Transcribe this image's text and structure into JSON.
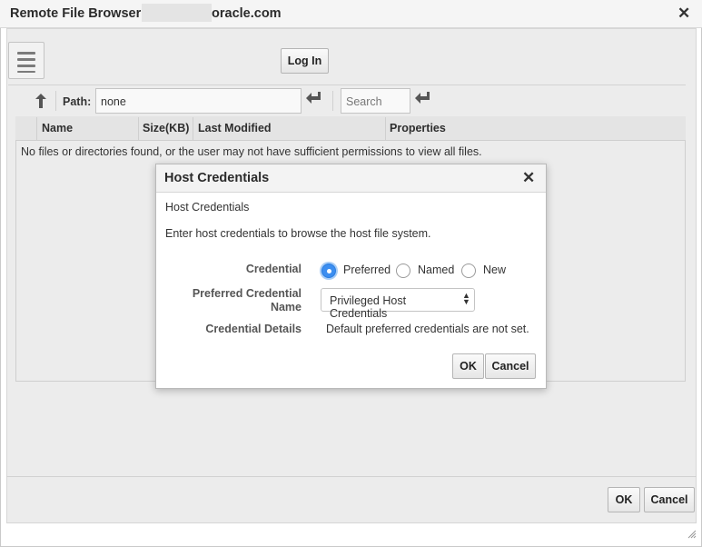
{
  "window": {
    "title_prefix": "Remote File Browser:",
    "title_suffix": "oracle.com"
  },
  "toolbar": {
    "login_label": "Log In",
    "path_label": "Path:",
    "path_value": "none",
    "search_placeholder": "Search"
  },
  "table": {
    "columns": [
      "Name",
      "Size(KB)",
      "Last Modified",
      "Properties"
    ],
    "empty_message": "No files or directories found, or the user may not have sufficient permissions to view all files."
  },
  "footer": {
    "ok_label": "OK",
    "cancel_label": "Cancel"
  },
  "modal": {
    "title": "Host Credentials",
    "subtitle": "Host Credentials",
    "description": "Enter host credentials to browse the host file system.",
    "credential_label": "Credential",
    "credential_options": [
      "Preferred",
      "Named",
      "New"
    ],
    "credential_selected": "Preferred",
    "preferred_name_label_line1": "Preferred Credential",
    "preferred_name_label_line2": "Name",
    "preferred_name_value": "Privileged Host Credentials",
    "details_label": "Credential Details",
    "details_value": "Default preferred credentials are not set.",
    "ok_label": "OK",
    "cancel_label": "Cancel"
  },
  "colors": {
    "accent": "#3c8ef0",
    "overlay_bg": "#ececec",
    "header_bg": "#f5f5f5"
  },
  "icons": {
    "close": "close-icon",
    "menu": "hamburger-menu-icon",
    "up": "up-folder-icon",
    "enter": "enter-return-icon",
    "resize": "resize-grip-icon"
  }
}
